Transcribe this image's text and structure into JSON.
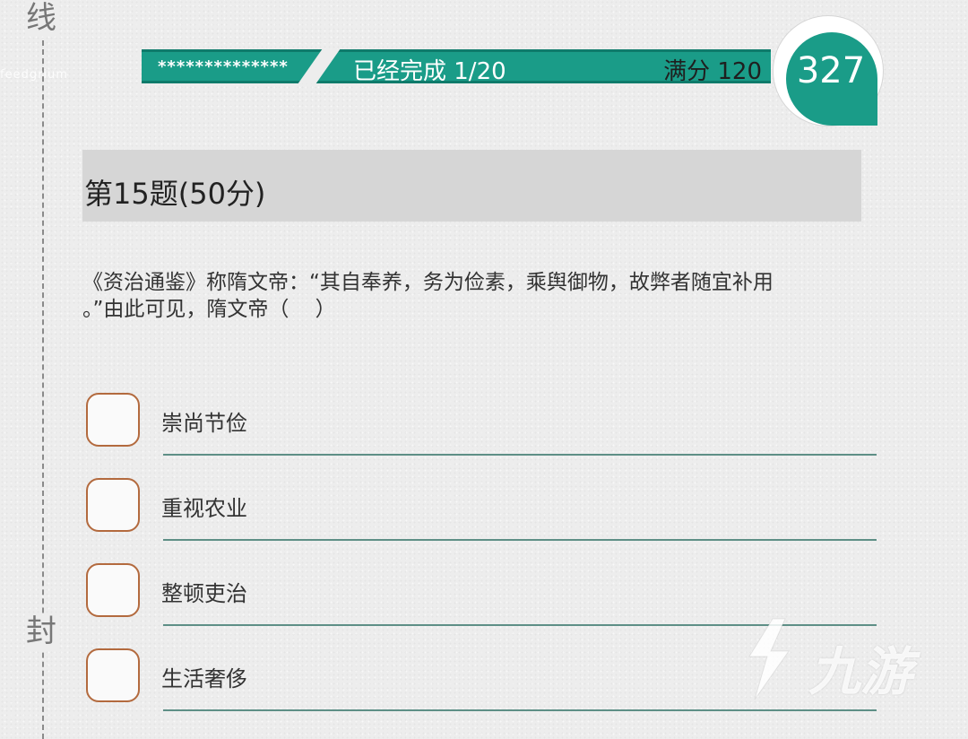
{
  "binding": {
    "top_char": "线",
    "bottom_char": "封"
  },
  "corner_url": "feedgrium",
  "header": {
    "stars": "**************",
    "progress": "已经完成  1/20",
    "full_score": "满分 120",
    "score": "327"
  },
  "question": {
    "title": "第15题(50分)",
    "text": "《资治通鉴》称隋文帝：“其自奉养，务为俭素，乘舆御物，故弊者随宜补用\n。”由此可见，隋文帝（    ）"
  },
  "options": [
    {
      "label": "崇尚节俭"
    },
    {
      "label": "重视农业"
    },
    {
      "label": "整顿吏治"
    },
    {
      "label": "生活奢侈"
    }
  ],
  "watermark": {
    "text": "九游"
  },
  "colors": {
    "accent": "#1a9c88",
    "option_border": "#b36a3e",
    "rule_line": "#5e8f86"
  }
}
